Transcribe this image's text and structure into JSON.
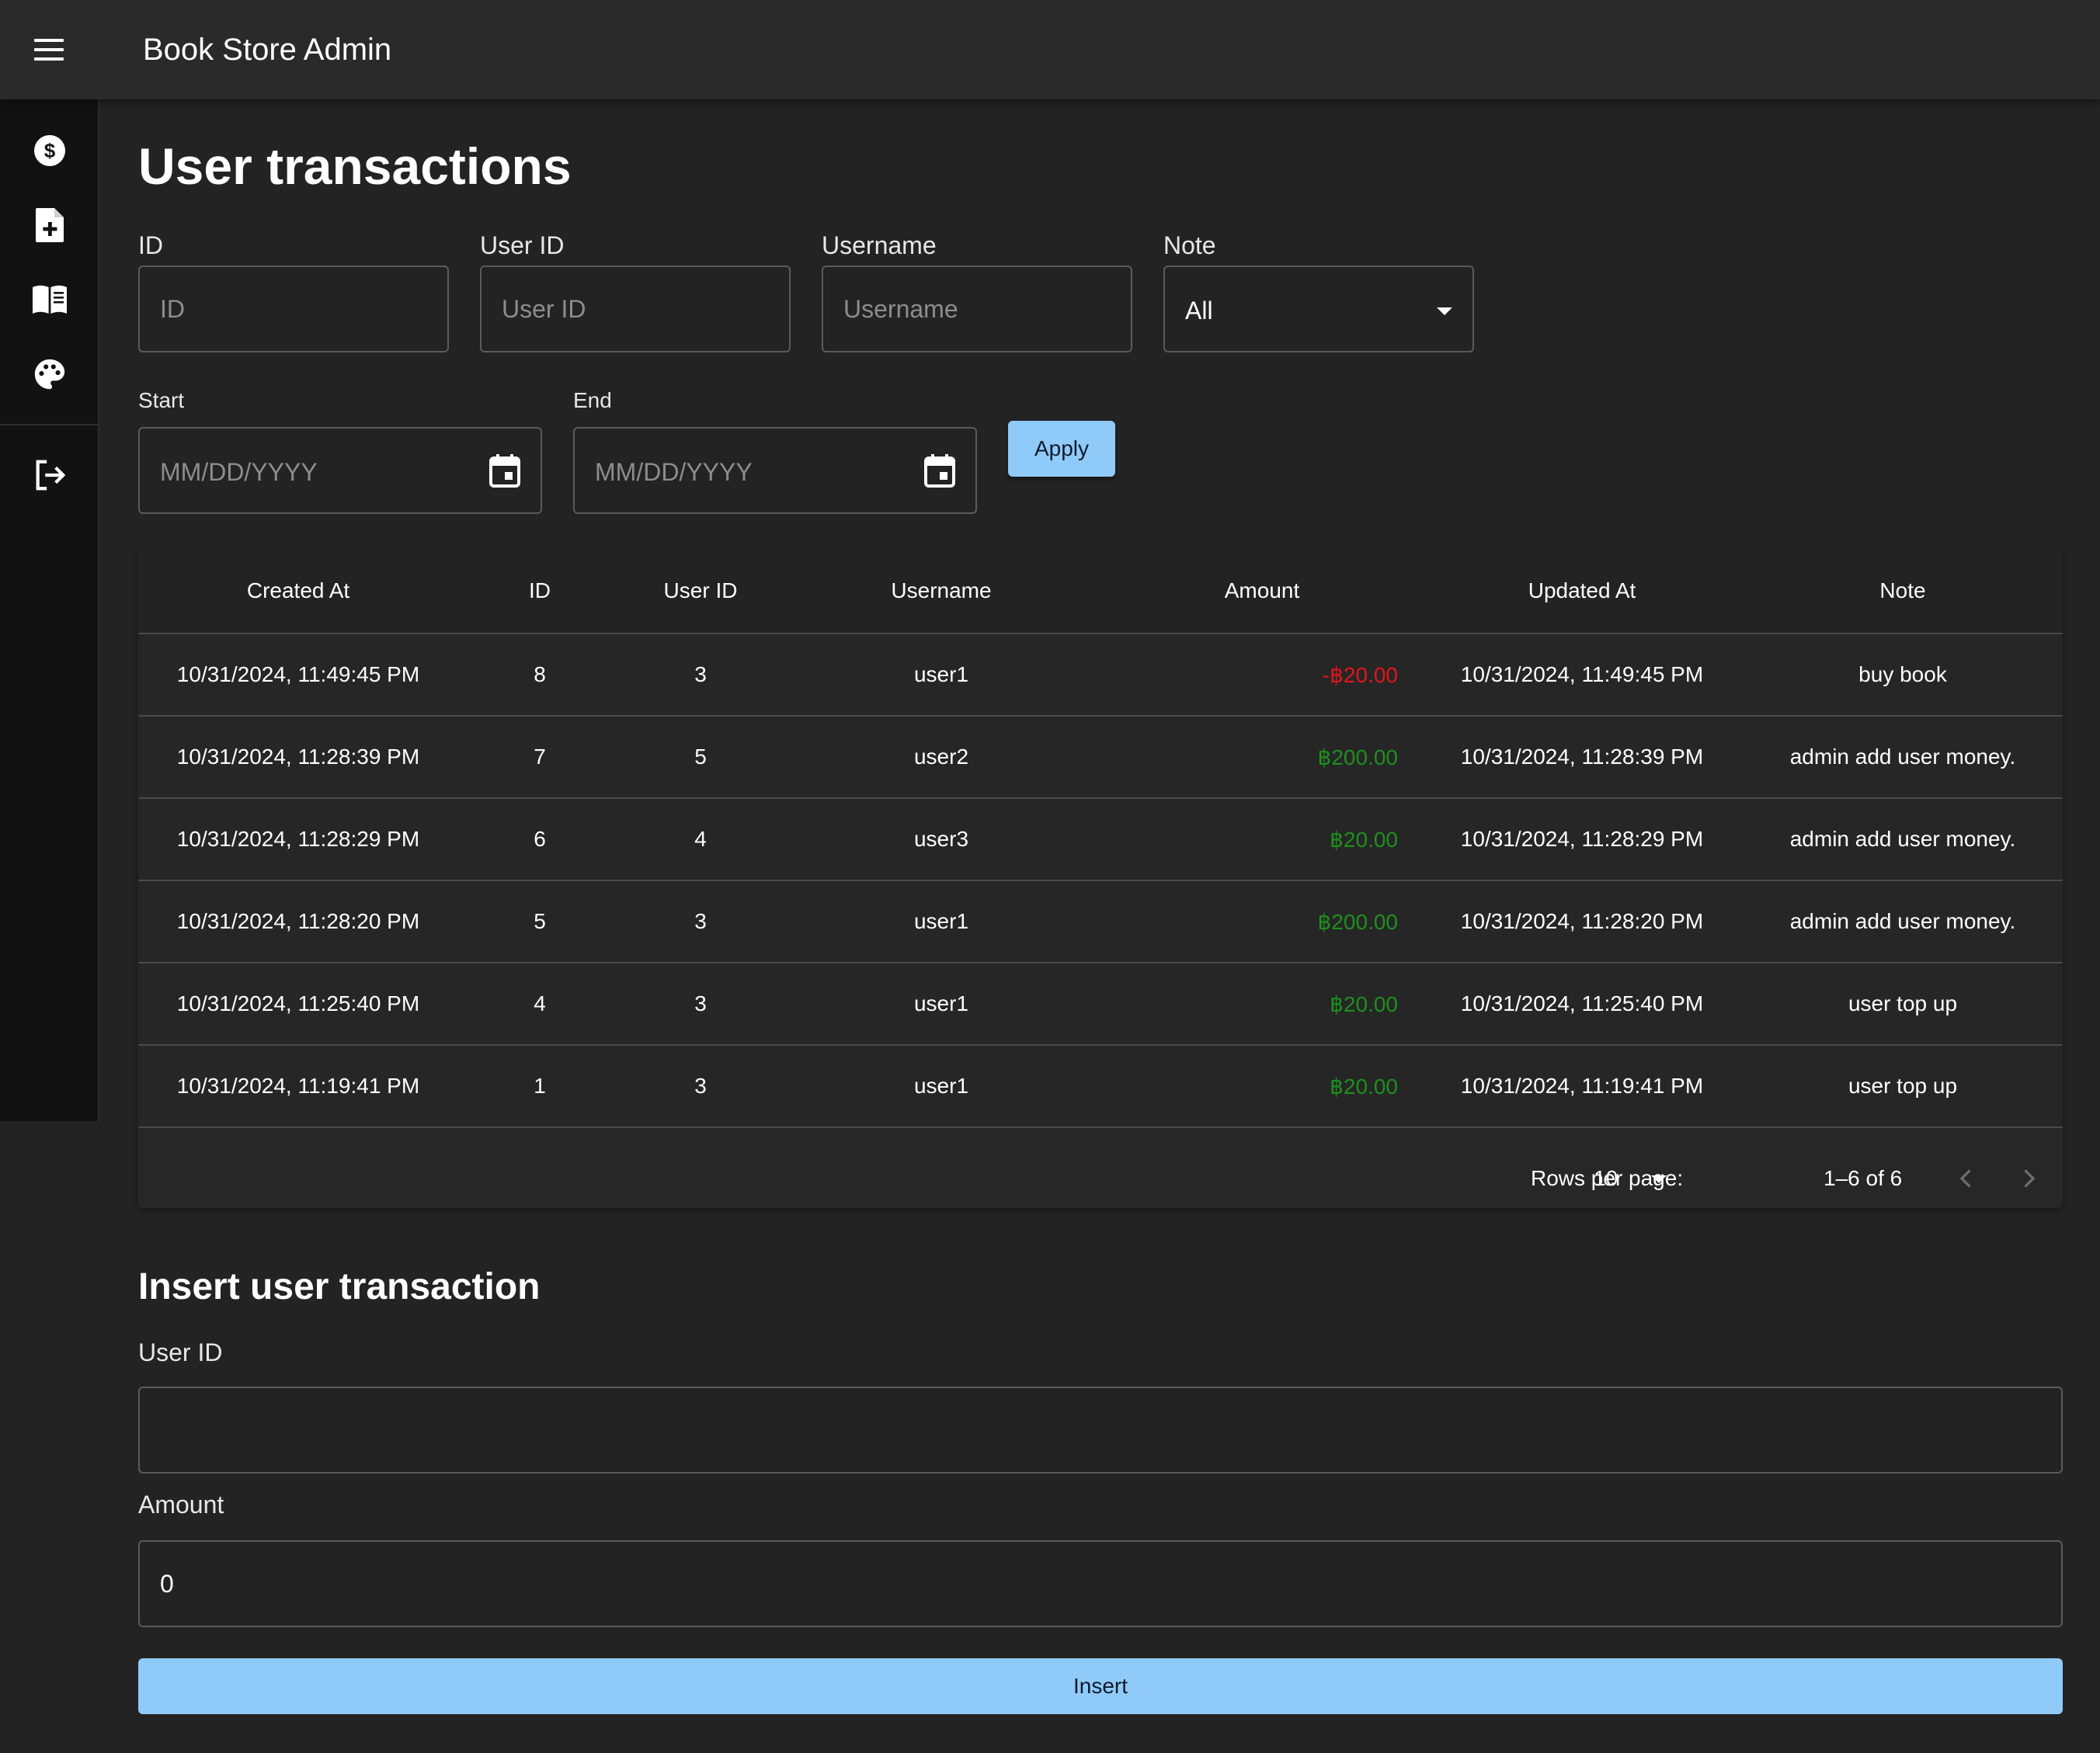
{
  "app": {
    "title": "Book Store Admin"
  },
  "sidebar": {
    "items": [
      {
        "icon": "dollar-icon"
      },
      {
        "icon": "add-document-icon"
      },
      {
        "icon": "book-icon"
      },
      {
        "icon": "palette-icon"
      }
    ],
    "logout_icon": "logout-icon"
  },
  "page": {
    "title": "User transactions"
  },
  "filters": {
    "id": {
      "label": "ID",
      "placeholder": "ID",
      "value": ""
    },
    "user_id": {
      "label": "User ID",
      "placeholder": "User ID",
      "value": ""
    },
    "username": {
      "label": "Username",
      "placeholder": "Username",
      "value": ""
    },
    "note": {
      "label": "Note",
      "value": "All"
    },
    "start": {
      "label": "Start",
      "placeholder": "MM/DD/YYYY"
    },
    "end": {
      "label": "End",
      "placeholder": "MM/DD/YYYY"
    },
    "apply_label": "Apply"
  },
  "table": {
    "columns": [
      "Created At",
      "ID",
      "User ID",
      "Username",
      "Amount",
      "Updated At",
      "Note"
    ],
    "rows": [
      {
        "created_at": "10/31/2024, 11:49:45 PM",
        "id": "8",
        "user_id": "3",
        "username": "user1",
        "amount": "-฿20.00",
        "amount_sign": "negative",
        "updated_at": "10/31/2024, 11:49:45 PM",
        "note": "buy book"
      },
      {
        "created_at": "10/31/2024, 11:28:39 PM",
        "id": "7",
        "user_id": "5",
        "username": "user2",
        "amount": "฿200.00",
        "amount_sign": "positive",
        "updated_at": "10/31/2024, 11:28:39 PM",
        "note": "admin add user money."
      },
      {
        "created_at": "10/31/2024, 11:28:29 PM",
        "id": "6",
        "user_id": "4",
        "username": "user3",
        "amount": "฿20.00",
        "amount_sign": "positive",
        "updated_at": "10/31/2024, 11:28:29 PM",
        "note": "admin add user money."
      },
      {
        "created_at": "10/31/2024, 11:28:20 PM",
        "id": "5",
        "user_id": "3",
        "username": "user1",
        "amount": "฿200.00",
        "amount_sign": "positive",
        "updated_at": "10/31/2024, 11:28:20 PM",
        "note": "admin add user money."
      },
      {
        "created_at": "10/31/2024, 11:25:40 PM",
        "id": "4",
        "user_id": "3",
        "username": "user1",
        "amount": "฿20.00",
        "amount_sign": "positive",
        "updated_at": "10/31/2024, 11:25:40 PM",
        "note": "user top up"
      },
      {
        "created_at": "10/31/2024, 11:19:41 PM",
        "id": "1",
        "user_id": "3",
        "username": "user1",
        "amount": "฿20.00",
        "amount_sign": "positive",
        "updated_at": "10/31/2024, 11:19:41 PM",
        "note": "user top up"
      }
    ],
    "pagination": {
      "rows_per_page_label": "Rows per page:",
      "rows_per_page": "10",
      "range": "1–6 of 6"
    }
  },
  "insert": {
    "title": "Insert user transaction",
    "user_id": {
      "label": "User ID",
      "value": ""
    },
    "amount": {
      "label": "Amount",
      "value": "0"
    },
    "button_label": "Insert"
  },
  "colors": {
    "accent": "#90caf9",
    "negative": "#e0161a",
    "positive": "#1e8f1e",
    "background": "#232323",
    "appbar": "#2a2a2a",
    "sidebar": "#121212"
  }
}
